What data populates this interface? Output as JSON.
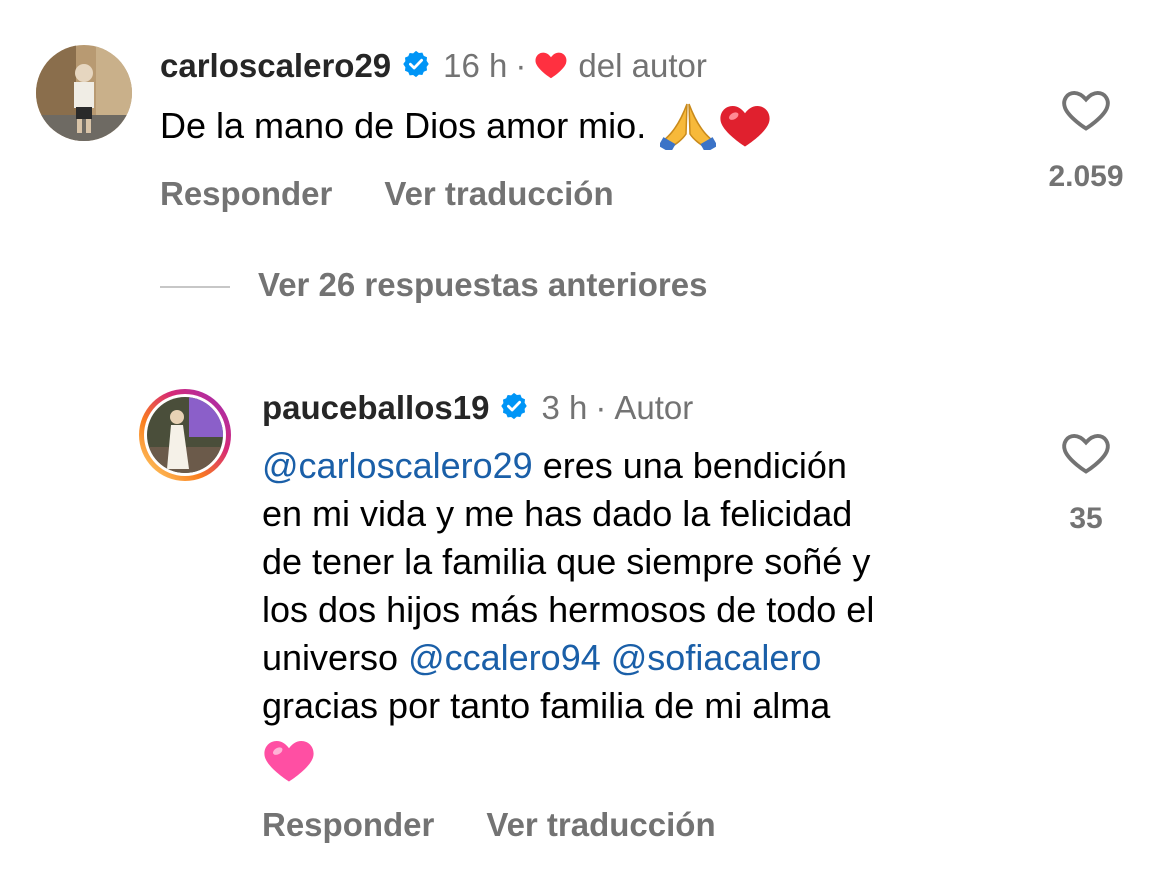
{
  "comment": {
    "username": "carloscalero29",
    "time": "16 h",
    "author_like": "del autor",
    "text": "De la mano de Dios amor mio.",
    "likes": "2.059",
    "reply_label": "Responder",
    "translate_label": "Ver traducción"
  },
  "view_previous": "Ver 26 respuestas anteriores",
  "reply": {
    "username": "pauceballos19",
    "time": "3 h",
    "author_tag": "Autor",
    "mention1": "@carloscalero29",
    "line1_rest": "eres una bendición",
    "line2": "en mi vida y me has dado la felicidad",
    "line3": "de tener la familia que siempre soñé y",
    "line4": "los dos hijos más hermosos de todo el",
    "line5_start": "universo",
    "mention2": "@ccalero94",
    "mention3": "@sofiacalero",
    "line6": "gracias por tanto familia de mi alma",
    "likes": "35",
    "reply_label": "Responder",
    "translate_label": "Ver traducción"
  },
  "colors": {
    "mention": "#1a5fa8",
    "verified": "#0095f6",
    "heart_red": "#ff3040",
    "heart_pink": "#ff4fa3",
    "story_ring": "gradient"
  }
}
